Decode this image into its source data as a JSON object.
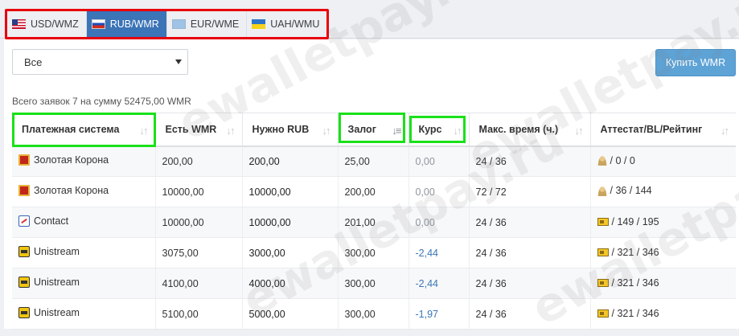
{
  "tabs": [
    {
      "label": "USD/WMZ",
      "flag": "us-flag-icon",
      "active": false
    },
    {
      "label": "RUB/WMR",
      "flag": "ru-flag-icon",
      "active": true
    },
    {
      "label": "EUR/WME",
      "flag": "eu-flag-icon",
      "active": false
    },
    {
      "label": "UAH/WMU",
      "flag": "ua-flag-icon",
      "active": false
    }
  ],
  "filter": {
    "selected": "Все"
  },
  "buy_button": "Купить WMR",
  "summary": "Всего заявок 7 на сумму 52475,00 WMR",
  "table": {
    "headers": [
      "Платежная система",
      "Есть WMR",
      "Нужно RUB",
      "Залог",
      "Курс",
      "Макс. время (ч.)",
      "Аттестат/BL/Рейтинг"
    ],
    "rows": [
      {
        "system": "Золотая Корона",
        "icon": "zolotaya-korona-icon",
        "have": "200,00",
        "need": "200,00",
        "deposit": "25,00",
        "rate": "0,00",
        "time": "24 / 36",
        "att_icon": "personal-attestat-icon",
        "att": " / 0 / 0"
      },
      {
        "system": "Золотая Корона",
        "icon": "zolotaya-korona-icon",
        "have": "10000,00",
        "need": "10000,00",
        "deposit": "200,00",
        "rate": "0,00",
        "time": "72 / 72",
        "att_icon": "personal-attestat-icon",
        "att": " / 36 / 144"
      },
      {
        "system": "Contact",
        "icon": "contact-icon",
        "have": "10000,00",
        "need": "10000,00",
        "deposit": "201,00",
        "rate": "0,00",
        "time": "24 / 36",
        "att_icon": "certificate-icon",
        "att": " / 149 / 195"
      },
      {
        "system": "Unistream",
        "icon": "unistream-icon",
        "have": "3075,00",
        "need": "3000,00",
        "deposit": "300,00",
        "rate": "-2,44",
        "time": "24 / 36",
        "att_icon": "certificate-icon",
        "att": " / 321 / 346"
      },
      {
        "system": "Unistream",
        "icon": "unistream-icon",
        "have": "4100,00",
        "need": "4000,00",
        "deposit": "300,00",
        "rate": "-2,44",
        "time": "24 / 36",
        "att_icon": "certificate-icon",
        "att": " / 321 / 346"
      },
      {
        "system": "Unistream",
        "icon": "unistream-icon",
        "have": "5100,00",
        "need": "5000,00",
        "deposit": "300,00",
        "rate": "-1,97",
        "time": "24 / 36",
        "att_icon": "certificate-icon",
        "att": " / 321 / 346"
      }
    ]
  },
  "watermark": "ewalletpay.ru"
}
